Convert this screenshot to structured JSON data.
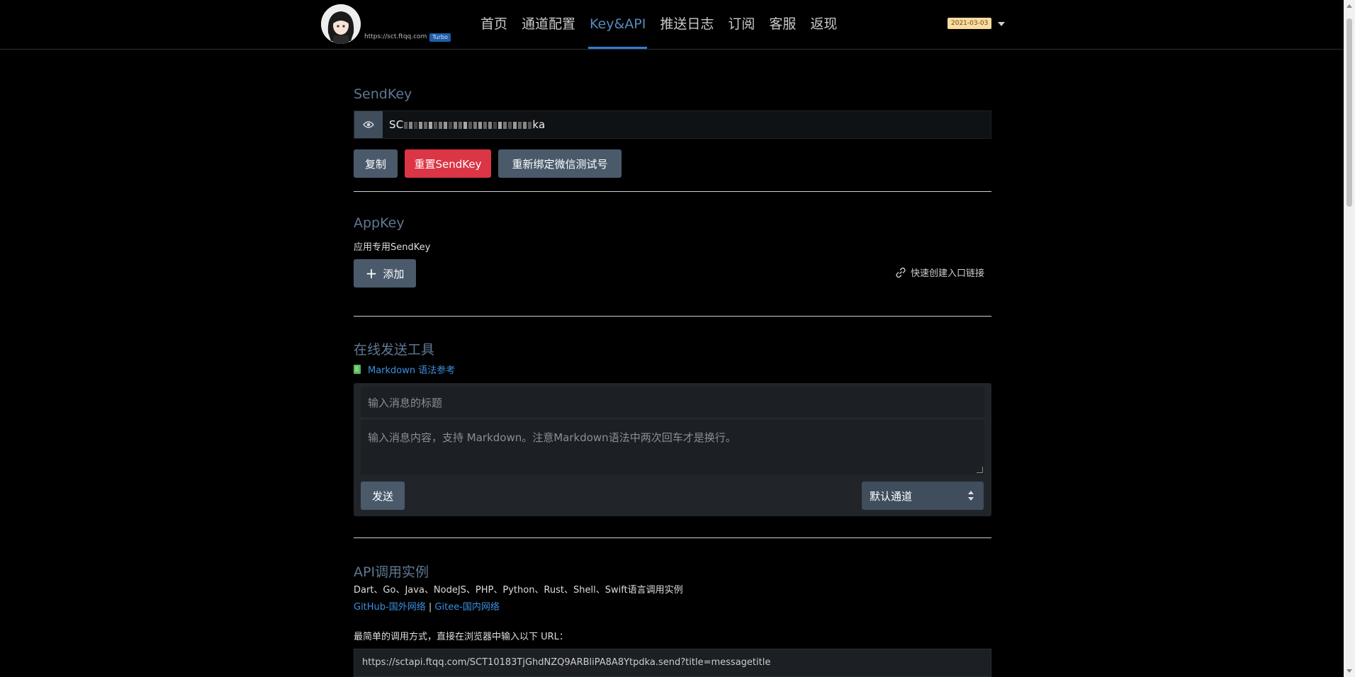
{
  "header": {
    "site_url": "https://sct.ftqq.com",
    "badge": "Turbo",
    "nav": [
      {
        "label": "首页",
        "active": false
      },
      {
        "label": "通道配置",
        "active": false
      },
      {
        "label": "Key&API",
        "active": true
      },
      {
        "label": "推送日志",
        "active": false
      },
      {
        "label": "订阅",
        "active": false
      },
      {
        "label": "客服",
        "active": false
      },
      {
        "label": "返现",
        "active": false
      }
    ],
    "date": "2021-03-03"
  },
  "sendkey": {
    "title": "SendKey",
    "key_prefix": "SC",
    "key_suffix": "ka",
    "buttons": {
      "copy": "复制",
      "reset": "重置SendKey",
      "rebind": "重新绑定微信测试号"
    }
  },
  "appkey": {
    "title": "AppKey",
    "subtitle": "应用专用SendKey",
    "add_label": "添加",
    "quick_link": "快速创建入口链接"
  },
  "online_tool": {
    "title": "在线发送工具",
    "markdown_link": "Markdown 语法参考",
    "title_placeholder": "输入消息的标题",
    "body_placeholder": "输入消息内容，支持 Markdown。注意Markdown语法中两次回车才是换行。",
    "send_label": "发送",
    "channel_selected": "默认通道"
  },
  "api": {
    "title": "API调用实例",
    "languages": "Dart、Go、Java、NodeJS、PHP、Python、Rust、Shell、Swift语言调用实例",
    "github_link": "GitHub-国外网络",
    "separator": "|",
    "gitee_link": "Gitee-国内网络",
    "simple_desc": "最简单的调用方式，直接在浏览器中输入以下 URL：",
    "url": "https://sctapi.ftqq.com/SCT10183TjGhdNZQ9ARBliPA8A8Ytpdka.send?title=messagetitle"
  },
  "colors": {
    "accent": "#2f7fd0",
    "section_title": "#5f7893",
    "button": "#4a5a6b",
    "danger": "#dc3545",
    "link": "#3d8fe0"
  }
}
